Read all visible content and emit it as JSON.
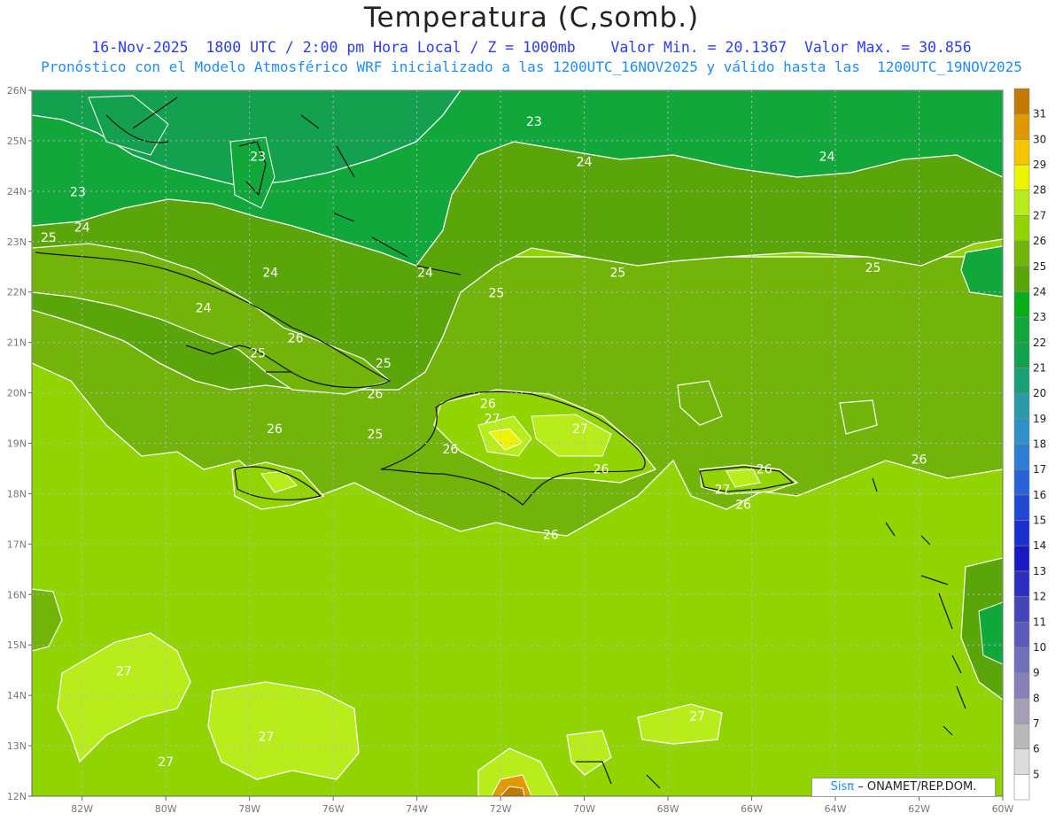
{
  "header": {
    "title": "Temperatura (C,somb.)",
    "subtitle_1": "16-Nov-2025  1800 UTC / 2:00 pm Hora Local / Z = 1000mb    Valor Min. = 20.1367  Valor Max. = 30.856",
    "subtitle_2": "Pronóstico con el Modelo Atmosférico WRF inicializado a las 1200UTC_16NOV2025 y válido hasta las  1200UTC_19NOV2025"
  },
  "map": {
    "lon_range": [
      -83.2,
      -60
    ],
    "lat_range": [
      12,
      26
    ],
    "lon_ticks": [
      "82W",
      "80W",
      "78W",
      "76W",
      "74W",
      "72W",
      "70W",
      "68W",
      "66W",
      "64W",
      "62W",
      "60W"
    ],
    "lat_ticks": [
      "12N",
      "13N",
      "14N",
      "15N",
      "16N",
      "17N",
      "18N",
      "19N",
      "20N",
      "21N",
      "22N",
      "23N",
      "24N",
      "25N",
      "26N"
    ],
    "contour_labels": [
      {
        "text": "23",
        "lon": -71.2,
        "lat": 25.3
      },
      {
        "text": "24",
        "lon": -70.0,
        "lat": 24.5
      },
      {
        "text": "24",
        "lon": -64.2,
        "lat": 24.6
      },
      {
        "text": "23",
        "lon": -82.1,
        "lat": 23.9
      },
      {
        "text": "23",
        "lon": -77.8,
        "lat": 24.6
      },
      {
        "text": "24",
        "lon": -82.0,
        "lat": 23.2
      },
      {
        "text": "25",
        "lon": -82.8,
        "lat": 23.0
      },
      {
        "text": "24",
        "lon": -73.8,
        "lat": 22.3
      },
      {
        "text": "25",
        "lon": -69.2,
        "lat": 22.3
      },
      {
        "text": "25",
        "lon": -63.1,
        "lat": 22.4
      },
      {
        "text": "24",
        "lon": -77.5,
        "lat": 22.3
      },
      {
        "text": "24",
        "lon": -79.1,
        "lat": 21.6
      },
      {
        "text": "25",
        "lon": -72.1,
        "lat": 21.9
      },
      {
        "text": "26",
        "lon": -76.9,
        "lat": 21.0
      },
      {
        "text": "25",
        "lon": -77.8,
        "lat": 20.7
      },
      {
        "text": "25",
        "lon": -74.8,
        "lat": 20.5
      },
      {
        "text": "26",
        "lon": -75.0,
        "lat": 19.9
      },
      {
        "text": "26",
        "lon": -77.4,
        "lat": 19.2
      },
      {
        "text": "25",
        "lon": -75.0,
        "lat": 19.1
      },
      {
        "text": "26",
        "lon": -72.3,
        "lat": 19.7
      },
      {
        "text": "27",
        "lon": -72.2,
        "lat": 19.4
      },
      {
        "text": "27",
        "lon": -70.1,
        "lat": 19.2
      },
      {
        "text": "26",
        "lon": -73.2,
        "lat": 18.8
      },
      {
        "text": "26",
        "lon": -69.6,
        "lat": 18.4
      },
      {
        "text": "27",
        "lon": -66.7,
        "lat": 18.0
      },
      {
        "text": "26",
        "lon": -65.7,
        "lat": 18.4
      },
      {
        "text": "26",
        "lon": -66.2,
        "lat": 17.7
      },
      {
        "text": "26",
        "lon": -62.0,
        "lat": 18.6
      },
      {
        "text": "26",
        "lon": -70.8,
        "lat": 17.1
      },
      {
        "text": "27",
        "lon": -81.0,
        "lat": 14.4
      },
      {
        "text": "27",
        "lon": -77.6,
        "lat": 13.1
      },
      {
        "text": "27",
        "lon": -80.0,
        "lat": 12.6
      },
      {
        "text": "27",
        "lon": -67.3,
        "lat": 13.5
      }
    ]
  },
  "colorbar": {
    "labels": [
      "5",
      "6",
      "7",
      "8",
      "9",
      "10",
      "11",
      "12",
      "13",
      "14",
      "15",
      "16",
      "17",
      "18",
      "19",
      "20",
      "21",
      "22",
      "23",
      "24",
      "25",
      "26",
      "27",
      "28",
      "29",
      "30",
      "31"
    ],
    "colors": [
      "#ffffff",
      "#dcdcdc",
      "#b8b8b8",
      "#a7a0b4",
      "#8a80b8",
      "#7070bb",
      "#5a5ab8",
      "#4545b8",
      "#2d2dbf",
      "#1919c4",
      "#1a2fcc",
      "#2046d4",
      "#2a62d8",
      "#2e7dd4",
      "#2e92c4",
      "#2a9aa8",
      "#1aa077",
      "#13a04f",
      "#12a73a",
      "#08ad1a",
      "#5aa60a",
      "#73b40a",
      "#92d400",
      "#b8ec1a",
      "#ecf400",
      "#f7c400",
      "#e09a00",
      "#c07a00"
    ]
  },
  "credit": {
    "logo_text": "Sisπ",
    "text": "– ONAMET/REP.DOM."
  }
}
